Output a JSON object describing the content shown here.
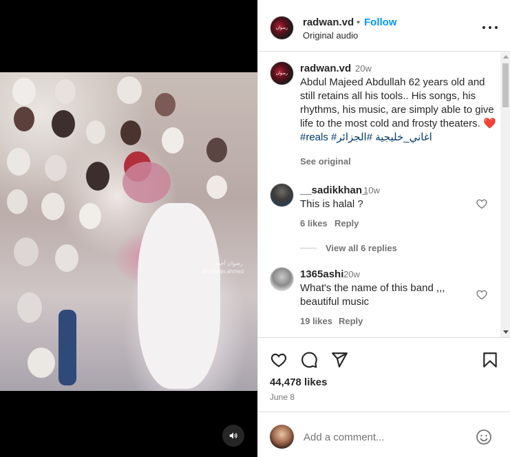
{
  "header": {
    "username": "radwan.vd",
    "separator": "•",
    "follow_label": "Follow",
    "audio_label": "Original audio",
    "avatar_text": "رضوان"
  },
  "video": {
    "watermark_line1": "رضوان أحمد",
    "watermark_line2": "@radwan.ahmed",
    "mute_icon": "speaker-icon"
  },
  "caption": {
    "username": "radwan.vd",
    "time": "20w",
    "text": "Abdul Majeed Abdullah 62 years old and still retains all his tools.. His songs, his rhythms, his music, are simply able to give life to the most cold and frosty theaters.",
    "heart": "❤️",
    "hashtag_reals": "#reals",
    "hashtag_khaleeji": "#اغاني_خليجية",
    "hashtag_algeria": "#الجزائر",
    "see_original": "See original"
  },
  "comments": [
    {
      "username": "__sadikkhan_",
      "time": "10w",
      "text": "This is halal ?",
      "likes": "6 likes",
      "reply": "Reply",
      "view_replies": "View all 6 replies"
    },
    {
      "username": "1365ashi",
      "time": "20w",
      "text": "What's the name of this band ,,, beautiful music",
      "likes": "19 likes",
      "reply": "Reply"
    }
  ],
  "actions": {
    "likes_count": "44,478 likes",
    "date": "June 8",
    "icons": [
      "heart-icon",
      "comment-icon",
      "share-icon",
      "save-icon"
    ]
  },
  "add_comment": {
    "placeholder": "Add a comment..."
  }
}
